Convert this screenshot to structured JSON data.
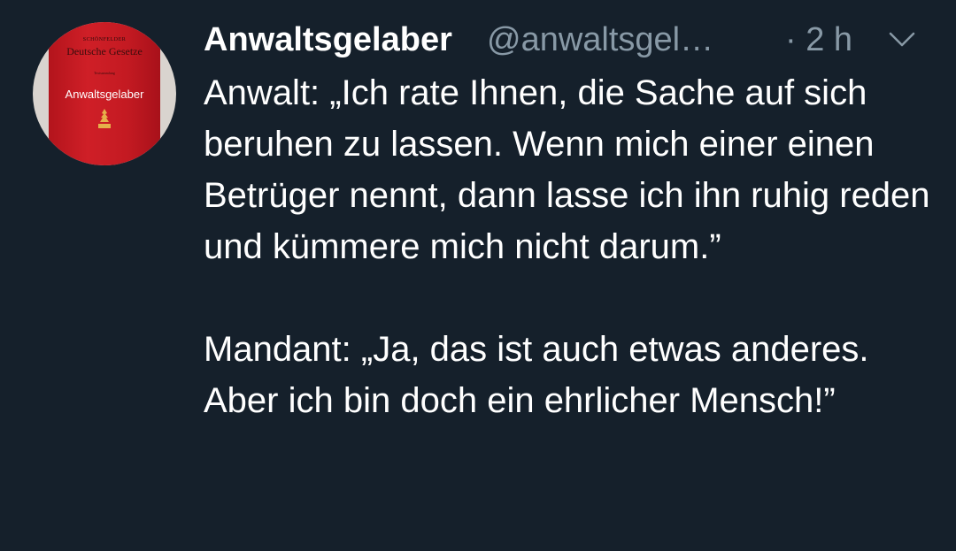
{
  "tweet": {
    "avatar": {
      "book_publisher": "SCHÖNFELDER",
      "book_title": "Deutsche Gesetze",
      "book_subtitle": "Textsammlung",
      "book_label": "Anwaltsgelaber",
      "colors": {
        "book_red": "#c41a22",
        "background": "#d9d4cf"
      }
    },
    "display_name": "Anwaltsgelaber",
    "handle": "@anwaltsgel…",
    "timestamp": "· 2 h",
    "menu_icon": "chevron-down-icon",
    "paragraphs": [
      "Anwalt: „Ich rate Ihnen, die Sache auf sich beruhen zu lassen. Wenn mich einer einen Betrüger nennt, dann lasse ich ihn ruhig reden und kümmere mich nicht darum.”",
      "Mandant: „Ja, das ist auch etwas anderes. Aber ich bin doch ein ehrlicher Mensch!”"
    ]
  },
  "colors": {
    "background": "#15202b",
    "primary_text": "#ffffff",
    "secondary_text": "#8899a6"
  }
}
